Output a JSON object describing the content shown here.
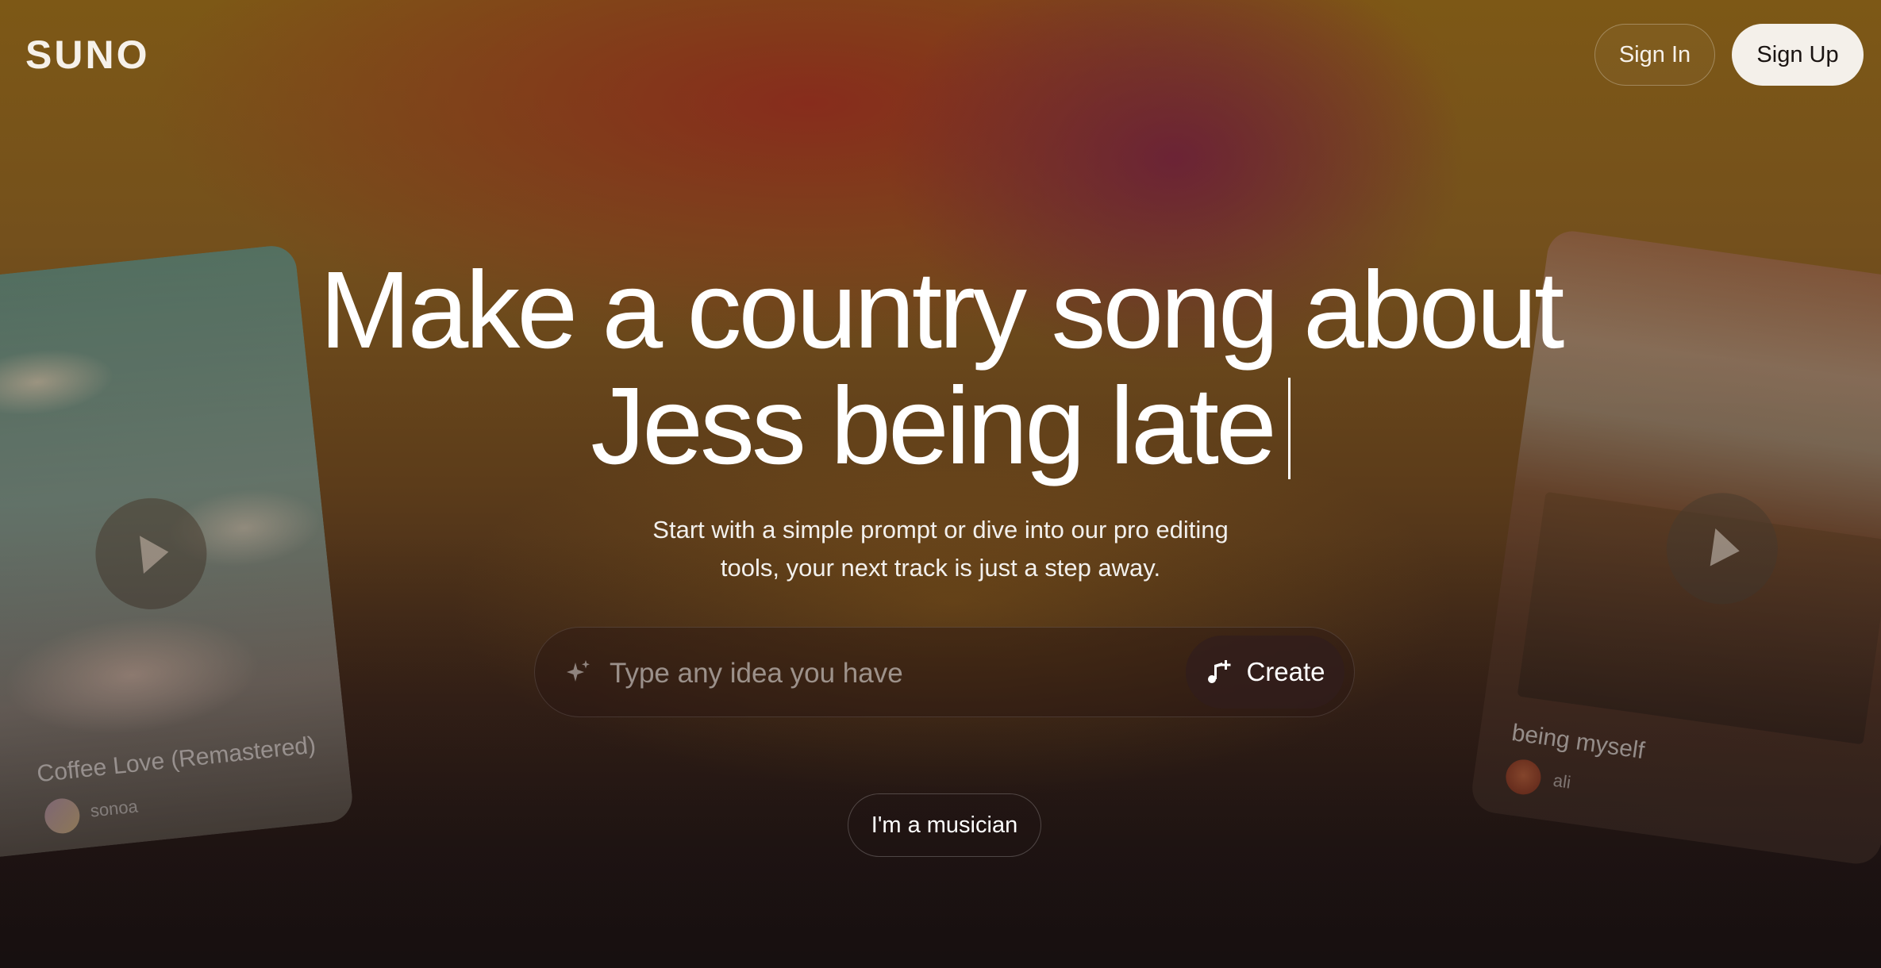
{
  "header": {
    "logo_text": "SUNO",
    "sign_in_label": "Sign In",
    "sign_up_label": "Sign Up"
  },
  "hero": {
    "headline_line1": "Make a country song about",
    "headline_line2": "Jess being late",
    "subtext_line1": "Start with a simple prompt or dive into our pro editing",
    "subtext_line2": "tools, your next track is just a step away."
  },
  "prompt": {
    "placeholder": "Type any idea you have",
    "value": "",
    "sparkle_icon": "sparkle-icon",
    "create_label": "Create",
    "create_icon": "music-note-plus-icon"
  },
  "musician_label": "I'm a musician",
  "cards": [
    {
      "title": "Coffee Love (Remastered)",
      "artist": "sonoa",
      "play_icon": "play-icon"
    },
    {
      "title": "being myself",
      "artist": "ali",
      "play_icon": "play-icon"
    }
  ],
  "colors": {
    "accent_light": "#f4f0ea",
    "background_dark": "#1c1513",
    "gradient_red": "#882a1c",
    "gradient_gold": "#7d5816"
  }
}
